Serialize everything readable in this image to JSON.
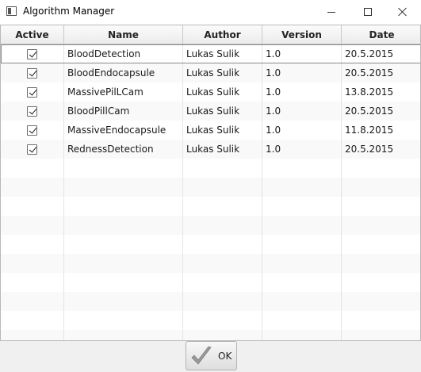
{
  "window": {
    "title": "Algorithm Manager",
    "icon": "window-app-icon"
  },
  "table": {
    "columns": [
      "Active",
      "Name",
      "Author",
      "Version",
      "Date"
    ],
    "rows": [
      {
        "active": true,
        "name": "BloodDetection",
        "author": "Lukas Sulik",
        "version": "1.0",
        "date": "20.5.2015",
        "selected": true
      },
      {
        "active": true,
        "name": "BloodEndocapsule",
        "author": "Lukas Sulik",
        "version": "1.0",
        "date": "20.5.2015"
      },
      {
        "active": true,
        "name": "MassivePilLCam",
        "author": "Lukas Sulik",
        "version": "1.0",
        "date": "13.8.2015"
      },
      {
        "active": true,
        "name": "BloodPillCam",
        "author": "Lukas Sulik",
        "version": "1.0",
        "date": "20.5.2015"
      },
      {
        "active": true,
        "name": "MassiveEndocapsule",
        "author": "Lukas Sulik",
        "version": "1.0",
        "date": "11.8.2015"
      },
      {
        "active": true,
        "name": "RednessDetection",
        "author": "Lukas Sulik",
        "version": "1.0",
        "date": "20.5.2015"
      }
    ]
  },
  "footer": {
    "ok_label": "OK",
    "ok_icon": "checkmark-icon"
  },
  "colors": {
    "checkmark": "#8a8a8a",
    "row_alt": "#f9f9f9"
  }
}
